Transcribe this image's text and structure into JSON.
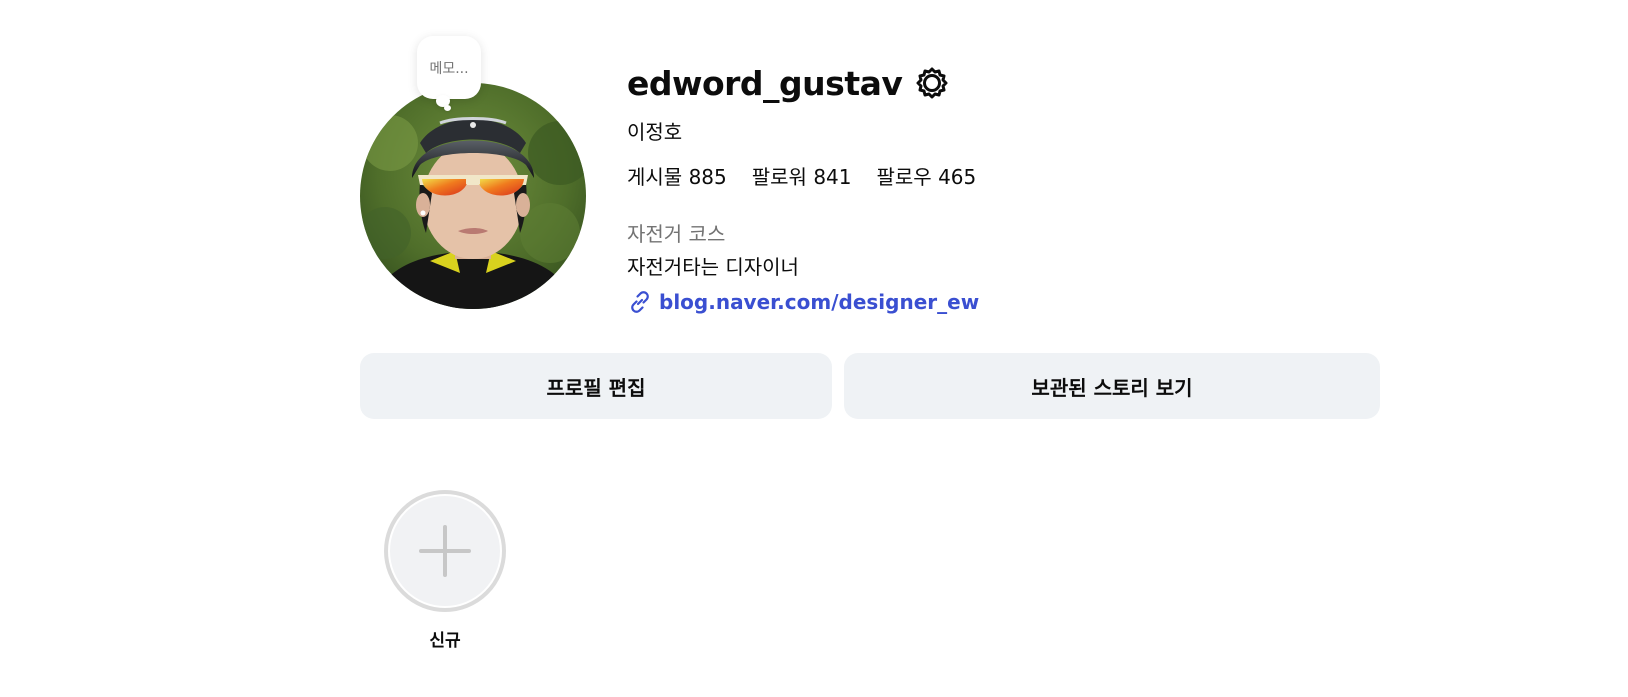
{
  "profile": {
    "note": "메모...",
    "username": "edword_gustav",
    "full_name": "이정호",
    "stats": [
      {
        "label": "게시물",
        "value": "885"
      },
      {
        "label": "팔로워",
        "value": "841"
      },
      {
        "label": "팔로우",
        "value": "465"
      }
    ],
    "category": "자전거 코스",
    "bio": "자전거타는 디자이너",
    "link": "blog.naver.com/designer_ew"
  },
  "actions": {
    "edit_profile": "프로필 편집",
    "view_archive": "보관된 스토리 보기"
  },
  "highlights": {
    "new_label": "신규"
  },
  "colors": {
    "button_bg": "#eff2f5",
    "link": "#3a4fd1",
    "muted_text": "#737373",
    "highlight_ring": "#dbdbdb"
  },
  "icons": {
    "settings": "gear-icon",
    "link": "link-icon",
    "add": "plus-icon"
  }
}
